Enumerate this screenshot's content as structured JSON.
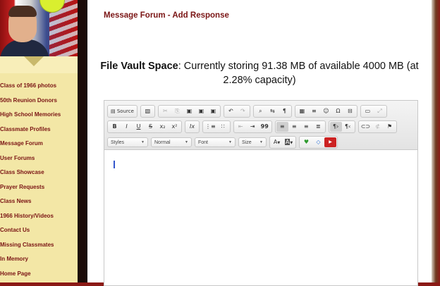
{
  "sidebar": {
    "nav_items": [
      "Class of 1966 photos",
      "50th Reunion Donors",
      "High School Memories",
      "Classmate Profiles",
      "Message Forum",
      "User Forums",
      "Class Showcase",
      "Prayer Requests",
      "Class News",
      "1966 History/Videos",
      "Contact Us",
      "Missing Classmates",
      "In Memory",
      "Home Page"
    ]
  },
  "header": {
    "title": "Message Forum - Add Response"
  },
  "vault": {
    "label": "File Vault Space",
    "text": ": Currently storing 91.38 MB of available 4000 MB (at 2.28% capacity)"
  },
  "editor": {
    "toolbar": {
      "source_label": "Source",
      "styles_label": "Styles",
      "format_label": "Normal",
      "font_label": "Font",
      "size_label": "Size",
      "bold": "B",
      "italic": "I",
      "underline": "U",
      "strike": "S",
      "subscript": "x₂",
      "superscript": "x²",
      "remove_format": "Ix",
      "blockquote": "99",
      "text_color": "A",
      "bg_color": "A",
      "omega": "Ω"
    },
    "body_text": ""
  }
}
